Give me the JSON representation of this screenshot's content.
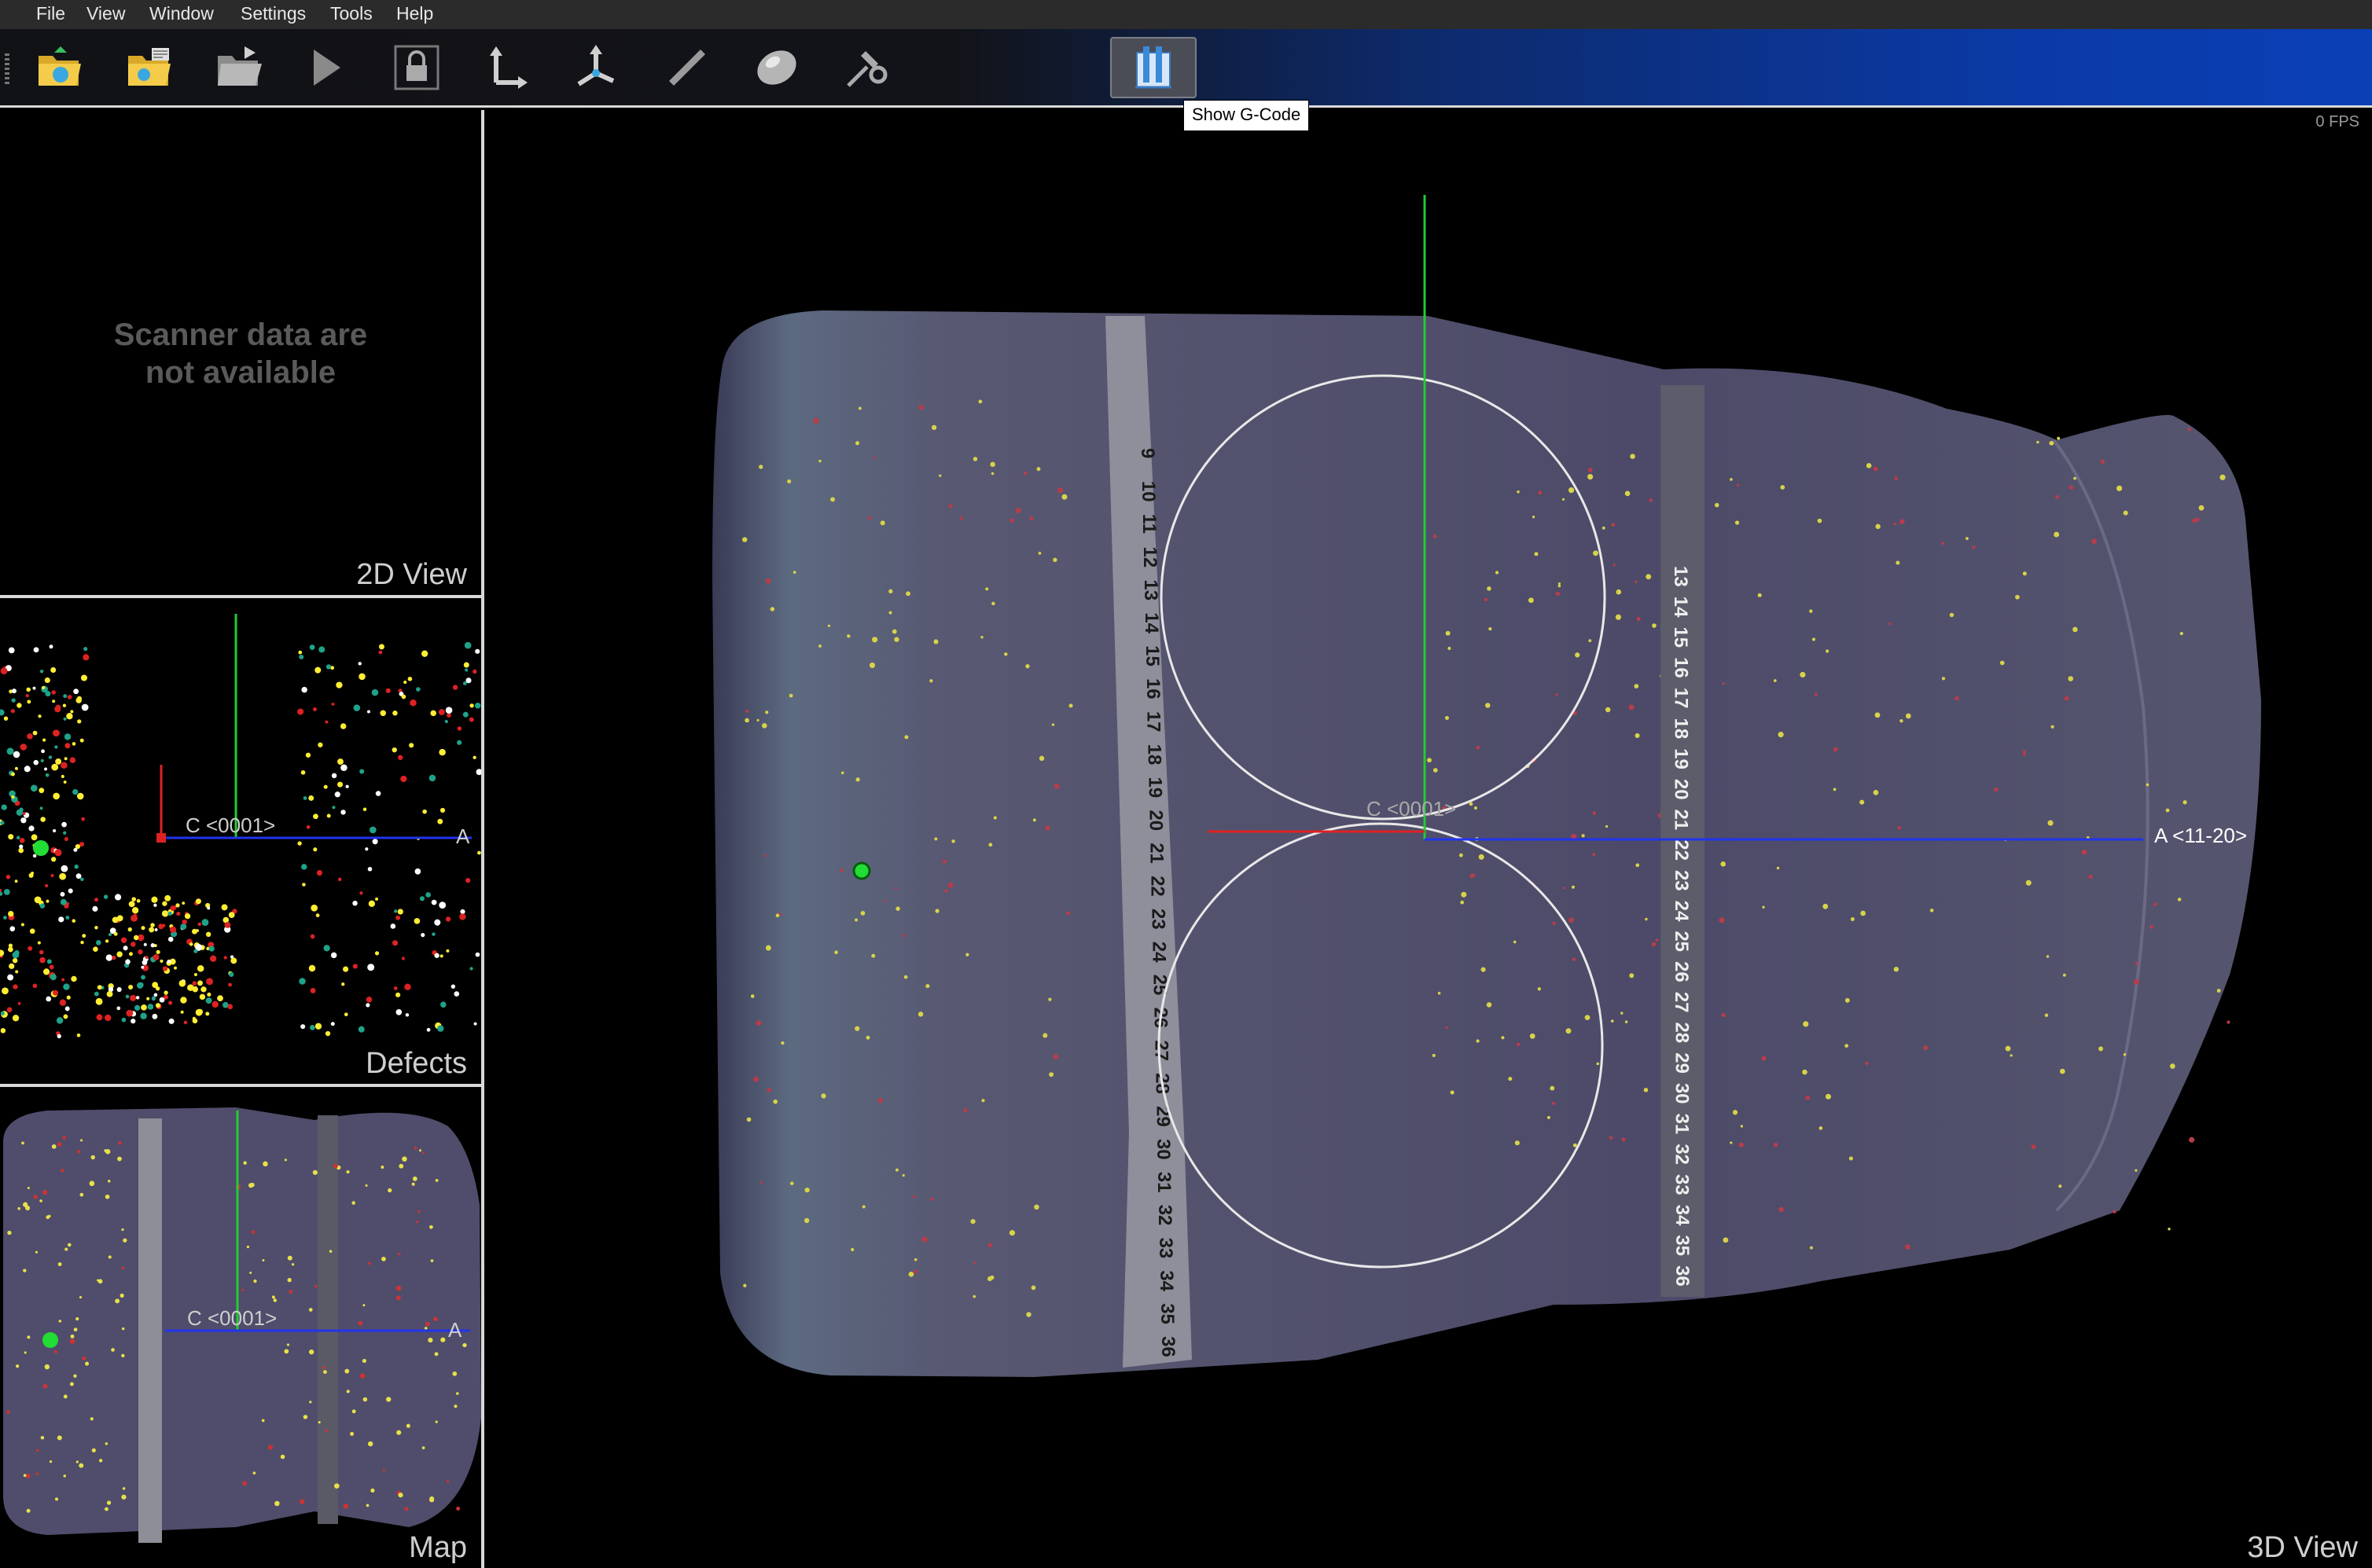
{
  "menu": {
    "items": [
      "File",
      "View",
      "Window",
      "Settings",
      "Tools",
      "Help"
    ]
  },
  "toolbar": {
    "buttons": [
      {
        "icon": "open-folder-icon"
      },
      {
        "icon": "open-project-icon"
      },
      {
        "icon": "open-folder-arrow-icon"
      },
      {
        "icon": "play-icon"
      },
      {
        "icon": "lock-icon"
      },
      {
        "icon": "axis-2d-icon"
      },
      {
        "icon": "axis-3d-icon"
      },
      {
        "icon": "ruler-icon"
      },
      {
        "icon": "lens-icon"
      },
      {
        "icon": "hammer-gear-icon"
      },
      {
        "icon": "show-gcode-icon"
      }
    ],
    "tooltip": "Show G-Code"
  },
  "panels": {
    "view2d": {
      "label": "2D View",
      "message_line1": "Scanner data are",
      "message_line2": "not available"
    },
    "defects": {
      "label": "Defects",
      "c_axis": "C <0001>",
      "a_axis": "A"
    },
    "map": {
      "label": "Map",
      "c_axis": "C <0001>",
      "a_axis": "A"
    },
    "view3d": {
      "label": "3D View",
      "fps": "0 FPS",
      "c_axis": "C <0001>",
      "a_axis": "A <11-20>"
    }
  },
  "tape_left_numbers": [
    "9",
    "10",
    "11",
    "12",
    "13",
    "14",
    "15",
    "16",
    "17",
    "18",
    "19",
    "20",
    "21",
    "22",
    "23",
    "24",
    "25",
    "26",
    "27",
    "28",
    "29",
    "30",
    "31",
    "32",
    "33",
    "34",
    "35",
    "36"
  ],
  "tape_right_numbers": [
    "13",
    "14",
    "15",
    "16",
    "17",
    "18",
    "19",
    "20",
    "21",
    "22",
    "23",
    "24",
    "25",
    "26",
    "27",
    "28",
    "29",
    "30",
    "31",
    "32",
    "33",
    "34",
    "35",
    "36"
  ],
  "colors": {
    "accent_blue": "#0a3fb6",
    "crystal": "#4f4d6b",
    "axis_green": "#22cc33",
    "axis_red": "#dd2222",
    "axis_blue": "#2233ee"
  }
}
